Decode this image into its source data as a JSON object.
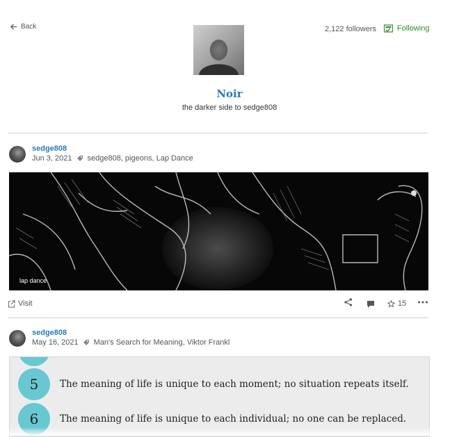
{
  "header": {
    "back_label": "Back",
    "followers": "2,122 followers",
    "following_label": "Following",
    "following_color": "#2a8c2a"
  },
  "blog": {
    "title": "Noir",
    "description": "the darker side to sedge808",
    "accent_color": "#2b7bb9"
  },
  "posts": [
    {
      "author": "sedge808",
      "date": "Jun 3, 2021",
      "tags": "sedge808, pigeons, Lap Dance",
      "image_caption": "lap dance",
      "visit_label": "Visit",
      "like_count": "15"
    },
    {
      "author": "sedge808",
      "date": "May 16, 2021",
      "tags": "Man's Search for Meaning, Viktor Frankl",
      "quotes": [
        {
          "number": "5",
          "text": "The meaning of life is unique to each moment; no situation repeats itself."
        },
        {
          "number": "6",
          "text": "The meaning of life is unique to each individual; no one can be replaced."
        }
      ]
    }
  ],
  "icons": [
    "back-arrow-icon",
    "following-icon",
    "tag-icon",
    "external-link-icon",
    "share-icon",
    "reblog-icon",
    "star-icon",
    "more-icon"
  ]
}
